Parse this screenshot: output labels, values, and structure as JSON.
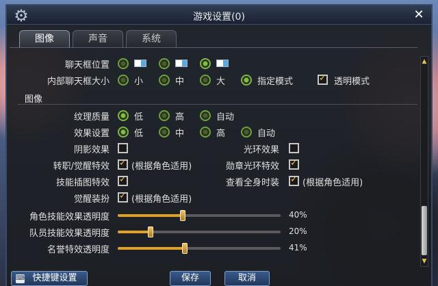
{
  "window": {
    "title": "游戏设置(0)",
    "close_glyph": "✕"
  },
  "tabs": [
    {
      "label": "图像",
      "active": true
    },
    {
      "label": "声音",
      "active": false
    },
    {
      "label": "系统",
      "active": false
    }
  ],
  "chat": {
    "position_label": "聊天框位置",
    "size_label": "内部聊天框大小",
    "size_options": [
      "小",
      "中",
      "大"
    ],
    "mode_label": "指定模式",
    "transparent_label": "透明模式"
  },
  "image_section": {
    "title": "图像",
    "texture_label": "纹理质量",
    "texture_options": [
      "低",
      "高",
      "自动"
    ],
    "effect_label": "效果设置",
    "effect_options": [
      "低",
      "中",
      "高",
      "自动"
    ],
    "shadow_label": "阴影效果",
    "halo_label": "光环效果",
    "awaken_effect_label": "转职/觉醒特效",
    "awaken_effect_option": "(根据角色适用)",
    "medal_label": "勋章光环特效",
    "skill_art_label": "技能插图特效",
    "fullbody_label": "查看全身时装",
    "fullbody_option": "(根据角色适用)",
    "awaken_outfit_label": "觉醒装扮",
    "awaken_outfit_option": "(根据角色适用)"
  },
  "sliders": [
    {
      "label": "角色技能效果透明度",
      "value_text": "40%",
      "value": 0.4
    },
    {
      "label": "队员技能效果透明度",
      "value_text": "20%",
      "value": 0.2
    },
    {
      "label": "名誉特效透明度",
      "value_text": "41%",
      "value": 0.41
    }
  ],
  "bottom": {
    "hotkey_label": "快捷键设置",
    "save_label": "保存",
    "cancel_label": "取消"
  },
  "colors": {
    "accent_green": "#7db844",
    "slider_fill": "#e0a020",
    "button_blue": "#22385a"
  }
}
